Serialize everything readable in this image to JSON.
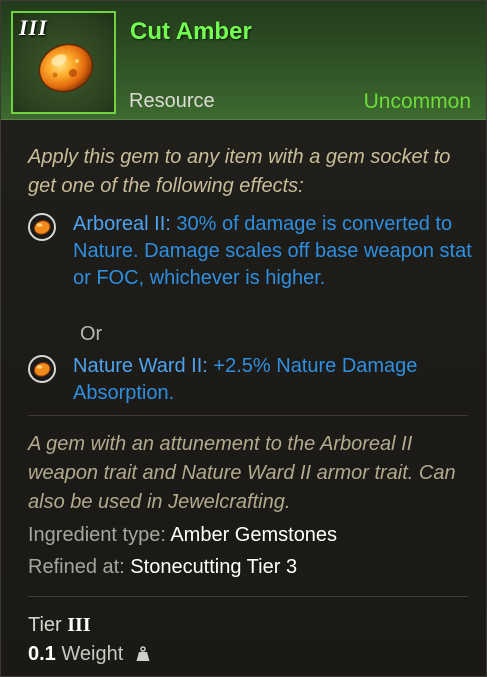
{
  "item": {
    "tier_numeral": "III",
    "name": "Cut Amber",
    "type": "Resource",
    "rarity": "Uncommon",
    "icon": "amber-gem-icon"
  },
  "description": "Apply this gem to any item with a gem socket to get one of the following effects:",
  "effects": [
    {
      "icon": "amber-gem-icon",
      "name": "Arboreal II:",
      "text": "30% of damage is converted to Nature. Damage scales off base weapon stat or FOC, whichever is higher."
    },
    {
      "icon": "amber-gem-icon",
      "name": "Nature Ward II:",
      "text": "+2.5% Nature Damage Absorption."
    }
  ],
  "separator_text": "Or",
  "flavor_text": "A gem with an attunement to the Arboreal II weapon trait and Nature Ward II armor trait. Can also be used in Jewelcrafting.",
  "properties": [
    {
      "label": "Ingredient type:",
      "value": "Amber Gemstones"
    },
    {
      "label": "Refined at:",
      "value": "Stonecutting Tier 3"
    }
  ],
  "tier": {
    "label": "Tier",
    "value": "III"
  },
  "weight": {
    "value": "0.1",
    "label": "Weight",
    "icon": "weight-icon"
  },
  "colors": {
    "title": "#73ff52",
    "rarity": "#6ddb3a",
    "effect": "#2e8fe0",
    "header_bg": "#345a29"
  }
}
